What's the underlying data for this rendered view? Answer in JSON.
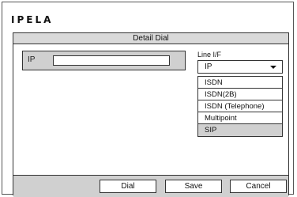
{
  "logo": "IPELA",
  "dialog": {
    "title": "Detail Dial",
    "ip_label": "IP",
    "ip_value": "",
    "line_if": {
      "label": "Line I/F",
      "selected": "IP",
      "options": [
        "ISDN",
        "ISDN(2B)",
        "ISDN (Telephone)",
        "Multipoint",
        "SIP"
      ],
      "highlighted": "SIP"
    },
    "buttons": {
      "dial": "Dial",
      "save": "Save",
      "cancel": "Cancel"
    }
  }
}
